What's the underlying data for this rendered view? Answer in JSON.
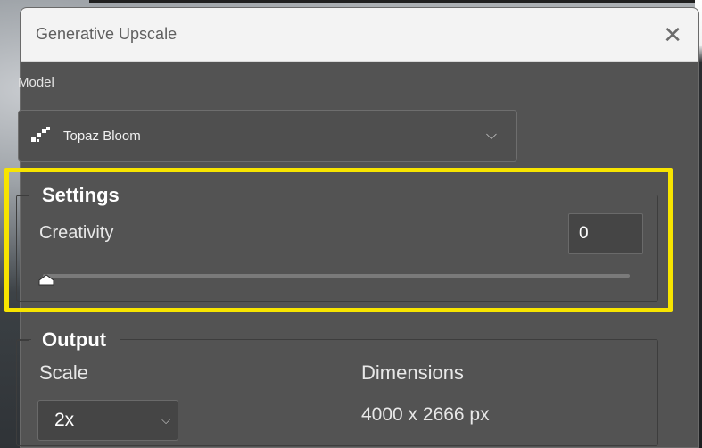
{
  "dialog": {
    "title": "Generative Upscale",
    "close_icon": "close-icon",
    "close_glyph": "✕"
  },
  "model": {
    "label": "Model",
    "selected": "Topaz Bloom",
    "icon": "topaz-bloom-icon",
    "chevron_glyph": "⌵"
  },
  "settings": {
    "legend": "Settings",
    "creativity_label": "Creativity",
    "creativity_value": "0",
    "slider_level": 0
  },
  "output": {
    "legend": "Output",
    "scale_label": "Scale",
    "scale_value": "2x",
    "scale_chevron_glyph": "⌵",
    "dimensions_label": "Dimensions",
    "dimensions_value": "4000 x 2666 px"
  },
  "colors": {
    "highlight": "#f7e400",
    "panel": "#535353",
    "titlebar": "#f3f3f3"
  }
}
